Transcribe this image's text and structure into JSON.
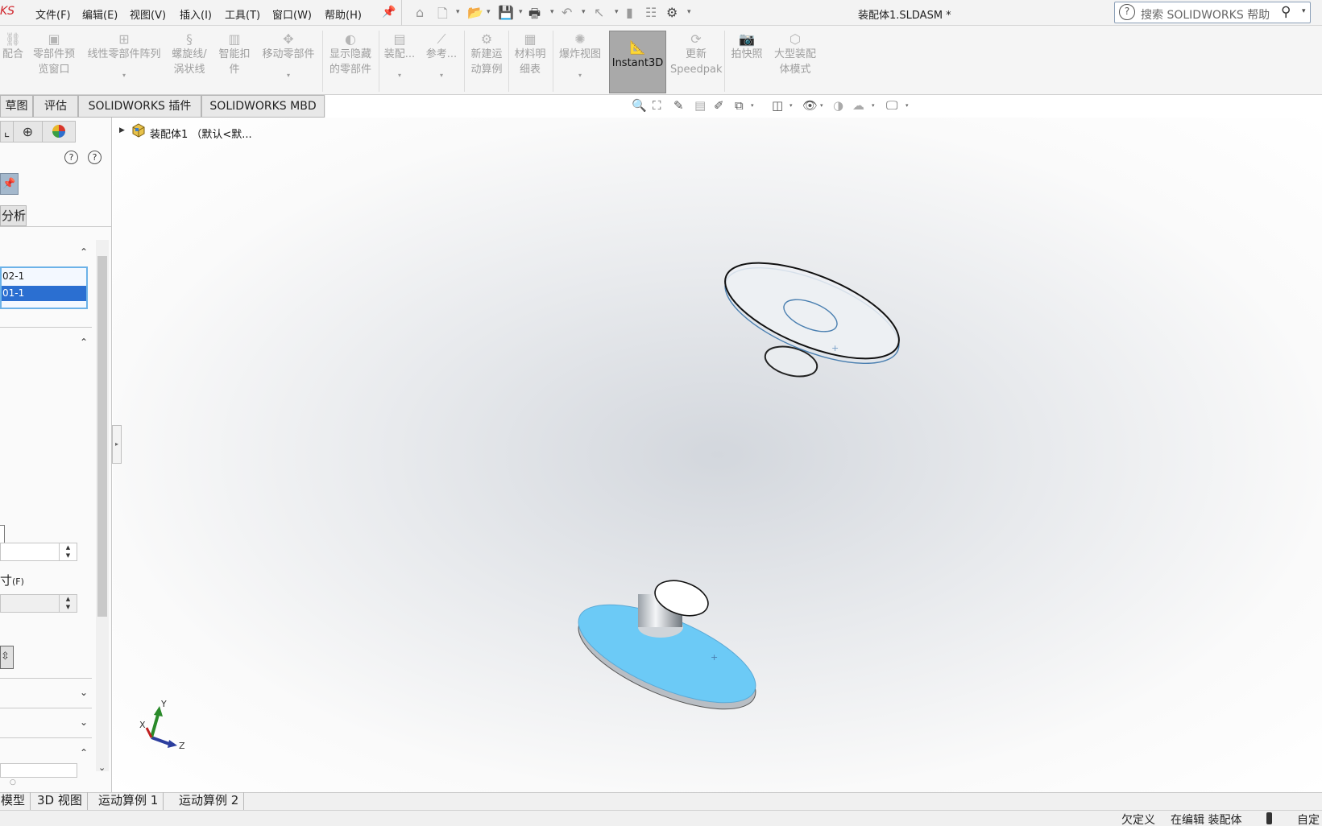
{
  "app": {
    "logo_text": "KS",
    "document_title": "装配体1.SLDASM *"
  },
  "menu": [
    "文件(F)",
    "编辑(E)",
    "视图(V)",
    "插入(I)",
    "工具(T)",
    "窗口(W)",
    "帮助(H)"
  ],
  "search": {
    "placeholder": "搜索 SOLIDWORKS 帮助",
    "help_glyph": "?"
  },
  "ribbon": {
    "mate": "配合",
    "component_preview": [
      "零部件预",
      "览窗口"
    ],
    "linear_pattern": "线性零部件阵列",
    "helix": [
      "螺旋线/",
      "涡状线"
    ],
    "smart_fastener": [
      "智能扣",
      "件"
    ],
    "move_component": "移动零部件",
    "show_hidden": [
      "显示隐藏",
      "的零部件"
    ],
    "assembly_features": "装配...",
    "reference": "参考...",
    "new_motion_study": [
      "新建运",
      "动算例"
    ],
    "bom": [
      "材料明",
      "细表"
    ],
    "exploded_view": "爆炸视图",
    "instant3d": "Instant3D",
    "update_speedpak": [
      "更新",
      "Speedpak"
    ],
    "snapshot": "拍快照",
    "large_assembly": [
      "大型装配",
      "体模式"
    ]
  },
  "command_tabs": [
    "草图",
    "评估",
    "SOLIDWORKS 插件",
    "SOLIDWORKS MBD"
  ],
  "left_panel": {
    "tab_partial": "分析",
    "list_items": [
      "02-1",
      "01-1"
    ],
    "dim_label": "寸",
    "dim_label_suffix": "(F)"
  },
  "tree": {
    "root_label": "装配体1 （默认<默..."
  },
  "triad": {
    "x": "X",
    "y": "Y",
    "z": "Z"
  },
  "bottom_tabs": [
    "模型",
    "3D 视图",
    "运动算例 1",
    "运动算例 2"
  ],
  "status": {
    "underdefined": "欠定义",
    "editing": "在编辑 装配体",
    "custom": "自定"
  },
  "colors": {
    "face_blue": "#6ccaf6",
    "selection": "#2b6fd1",
    "instant3d_active": "#a9a9a9"
  }
}
